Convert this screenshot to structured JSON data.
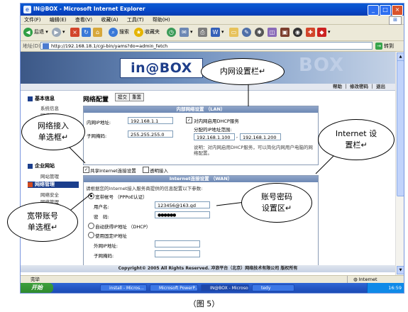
{
  "window": {
    "title": "IN@BOX - Microsoft Internet Explorer",
    "controls": [
      "_",
      "□",
      "×"
    ]
  },
  "menu": {
    "items": [
      "文件(F)",
      "编辑(E)",
      "查看(V)",
      "收藏(A)",
      "工具(T)",
      "帮助(H)"
    ]
  },
  "toolbar": {
    "back_label": "后退",
    "search_label": "搜索",
    "favorites_label": "收藏夹"
  },
  "address": {
    "label": "地址(D)",
    "url": "http://192.168.18.1/cgi-bin/yams?do=admin_fetch",
    "go_label": "转到"
  },
  "banner": {
    "logo": "in@BOX",
    "watermark": "BOX"
  },
  "topnav": {
    "links": "帮助 ｜ 修改密码 ｜ 退出"
  },
  "sidebar": {
    "sections": [
      {
        "title": "基本信息",
        "items": [
          "系统信息",
          "网络接入"
        ]
      },
      {
        "title": "企业网站",
        "items": [
          "网站管理"
        ]
      },
      {
        "title": "网络管理",
        "items": [
          "网络安全",
          "网络管理"
        ]
      }
    ]
  },
  "main": {
    "title": "网络配置",
    "submit_label": "提交",
    "reset_label": "重置",
    "lan": {
      "header": "内部网络设置 （LAN）",
      "ip_label": "内网IP地址:",
      "ip_value": "192.168.1.1",
      "mask_label": "子网掩码:",
      "mask_value": "255.255.255.0",
      "dhcp_label": "对内网启用DHCP服务",
      "range_label": "分配的IP地址范围:",
      "range_start": "192.168.1.100",
      "range_end": "192.168.1.200",
      "note": "说明：对内网启用DHCP服务，可以简化内网用户电脑的网络配置。"
    },
    "share_label": "共享Internet连接设置",
    "transparent_label": "透明接入",
    "wan": {
      "header": "Internet连接设置 （WAN）",
      "intro": "请根据您的Internet接入服务商提供的信息配置以下参数:",
      "pppoe_label": "宽带帐号 （PPPoE认证）",
      "user_label": "用户名:",
      "user_value": "123456@163.gd",
      "pwd_label": "密　码:",
      "pwd_value": "●●●●●●",
      "dhcp_label": "自动获得IP地址 （DHCP）",
      "static_label": "使用固定IP地址",
      "wan_ip_label": "外网IP地址:",
      "wan_mask_label": "子网掩码:"
    },
    "footer": "Copyright© 2005 All Rights Reserved. 冲浪平台（北京）网络技术有限公司 版权所有"
  },
  "statusbar": {
    "left": "完毕",
    "zone": "Internet"
  },
  "taskbar": {
    "start": "开始",
    "tasks": [
      "install - Micros...",
      "Microsoft PowerP...",
      "IN@BOX - Microso...",
      "tedy"
    ],
    "clock": "16:59"
  },
  "callouts": {
    "lan": "内网设置栏↵",
    "net_access": "网络接入\n单选框↵",
    "internet": "Internet 设\n置栏↵",
    "account": "账号密码\n设置区↵",
    "broadband": "宽带账号\n单选框↵"
  },
  "caption": "（图 5）"
}
